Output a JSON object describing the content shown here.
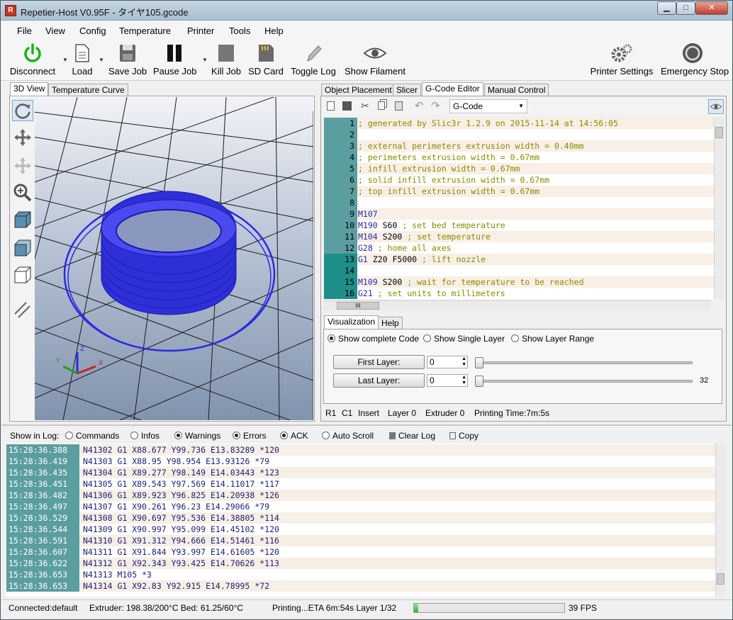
{
  "window": {
    "title": "Repetier-Host V0.95F - タイヤ105.gcode",
    "app_icon": "R",
    "controls": [
      "▁",
      "□",
      "✕"
    ]
  },
  "menu": [
    "File",
    "View",
    "Config",
    "Temperature",
    "Printer",
    "Tools",
    "Help"
  ],
  "toolbar": {
    "disconnect": "Disconnect",
    "load": "Load",
    "save_job": "Save Job",
    "pause_job": "Pause Job",
    "kill_job": "Kill Job",
    "sd_card": "SD Card",
    "toggle_log": "Toggle Log",
    "show_filament": "Show Filament",
    "printer_settings": "Printer Settings",
    "emergency_stop": "Emergency Stop"
  },
  "left_tabs": [
    "3D View",
    "Temperature Curve"
  ],
  "right_tabs": [
    "Object Placement",
    "Slicer",
    "G-Code Editor",
    "Manual Control"
  ],
  "editor": {
    "dropdown": "G-Code",
    "hscroll_label": "III",
    "lines": [
      {
        "n": "1",
        "parts": [
          {
            "t": "; generated by Slic3r 1.2.9 on 2015-11-14 at 14:56:05",
            "c": "cmt"
          }
        ]
      },
      {
        "n": "2",
        "parts": []
      },
      {
        "n": "3",
        "parts": [
          {
            "t": "; external perimeters extrusion width = 0.40mm",
            "c": "cmt"
          }
        ]
      },
      {
        "n": "4",
        "parts": [
          {
            "t": "; perimeters extrusion width = 0.67mm",
            "c": "cmt"
          }
        ]
      },
      {
        "n": "5",
        "parts": [
          {
            "t": "; infill extrusion width = 0.67mm",
            "c": "cmt"
          }
        ]
      },
      {
        "n": "6",
        "parts": [
          {
            "t": "; solid infill extrusion width = 0.67mm",
            "c": "cmt"
          }
        ]
      },
      {
        "n": "7",
        "parts": [
          {
            "t": "; top infill extrusion width = 0.67mm",
            "c": "cmt"
          }
        ]
      },
      {
        "n": "8",
        "parts": []
      },
      {
        "n": "9",
        "parts": [
          {
            "t": "M107",
            "c": "kw"
          }
        ]
      },
      {
        "n": "10",
        "parts": [
          {
            "t": "M190 ",
            "c": "kw"
          },
          {
            "t": "S60 ",
            "c": "kv"
          },
          {
            "t": "; set bed temperature",
            "c": "cmt"
          }
        ]
      },
      {
        "n": "11",
        "parts": [
          {
            "t": "M104 ",
            "c": "kw"
          },
          {
            "t": "S200 ",
            "c": "kv"
          },
          {
            "t": "; set temperature",
            "c": "cmt"
          }
        ]
      },
      {
        "n": "12",
        "parts": [
          {
            "t": "G28 ",
            "c": "kw"
          },
          {
            "t": "; home all axes",
            "c": "cmt"
          }
        ]
      },
      {
        "n": "13",
        "parts": [
          {
            "t": "G1 ",
            "c": "kw"
          },
          {
            "t": "Z20 F5000 ",
            "c": "kv"
          },
          {
            "t": "; lift nozzle",
            "c": "cmt"
          }
        ],
        "sel": true
      },
      {
        "n": "14",
        "parts": [],
        "sel": true
      },
      {
        "n": "15",
        "parts": [
          {
            "t": "M109 ",
            "c": "kw"
          },
          {
            "t": "S200 ",
            "c": "kv"
          },
          {
            "t": "; wait for temperature to be reached",
            "c": "cmt"
          }
        ],
        "sel": true
      },
      {
        "n": "16",
        "parts": [
          {
            "t": "G21 ",
            "c": "kw"
          },
          {
            "t": "; set units to millimeters",
            "c": "cmt"
          }
        ],
        "sel": true
      }
    ]
  },
  "viz": {
    "tabs": [
      "Visualization",
      "Help"
    ],
    "show_complete": "Show complete Code",
    "show_single": "Show Single Layer",
    "show_range": "Show Layer Range",
    "first_layer": "First Layer:",
    "last_layer": "Last Layer:",
    "first_val": "0",
    "last_val": "0",
    "max_layer": "32"
  },
  "editor_status": {
    "pos": "R1",
    "col": "C1",
    "mode": "Insert",
    "layer": "Layer 0",
    "extruder": "Extruder 0",
    "time": "Printing Time:7m:5s"
  },
  "logbar": {
    "label": "Show in Log:",
    "commands": "Commands",
    "infos": "Infos",
    "warnings": "Warnings",
    "errors": "Errors",
    "ack": "ACK",
    "autoscroll": "Auto Scroll",
    "clear": "Clear Log",
    "copy": "Copy"
  },
  "log": [
    {
      "ts": "15:28:36.388",
      "msg": "N41302 G1 X88.677 Y99.736 E13.83289 *120"
    },
    {
      "ts": "15:28:36.419",
      "msg": "N41303 G1 X88.95 Y98.954 E13.93126 *79"
    },
    {
      "ts": "15:28:36.435",
      "msg": "N41304 G1 X89.277 Y98.149 E14.03443 *123"
    },
    {
      "ts": "15:28:36.451",
      "msg": "N41305 G1 X89.543 Y97.569 E14.11017 *117"
    },
    {
      "ts": "15:28:36.482",
      "msg": "N41306 G1 X89.923 Y96.825 E14.20938 *126"
    },
    {
      "ts": "15:28:36.497",
      "msg": "N41307 G1 X90.261 Y96.23 E14.29066 *79"
    },
    {
      "ts": "15:28:36.529",
      "msg": "N41308 G1 X90.697 Y95.536 E14.38805 *114"
    },
    {
      "ts": "15:28:36.544",
      "msg": "N41309 G1 X90.997 Y95.099 E14.45102 *120"
    },
    {
      "ts": "15:28:36.591",
      "msg": "N41310 G1 X91.312 Y94.666 E14.51461 *116"
    },
    {
      "ts": "15:28:36.607",
      "msg": "N41311 G1 X91.844 Y93.997 E14.61605 *120"
    },
    {
      "ts": "15:28:36.622",
      "msg": "N41312 G1 X92.343 Y93.425 E14.70626 *113"
    },
    {
      "ts": "15:28:36.653",
      "msg": "N41313 M105 *3"
    },
    {
      "ts": "15:28:36.653",
      "msg": "N41314 G1 X92.83 Y92.915 E14.78995 *72"
    }
  ],
  "status": {
    "connection": "Connected:default",
    "temps": "Extruder: 198.38/200°C Bed: 61.25/60°C",
    "printing": "Printing...ETA 6m:54s Layer 1/32",
    "progress": 0.03,
    "fps": "39 FPS"
  },
  "colors": {
    "accent": "#5b9ea0",
    "selected_line": "#1f8f8a",
    "object": "#2a2ae0",
    "power": "#19b219"
  }
}
